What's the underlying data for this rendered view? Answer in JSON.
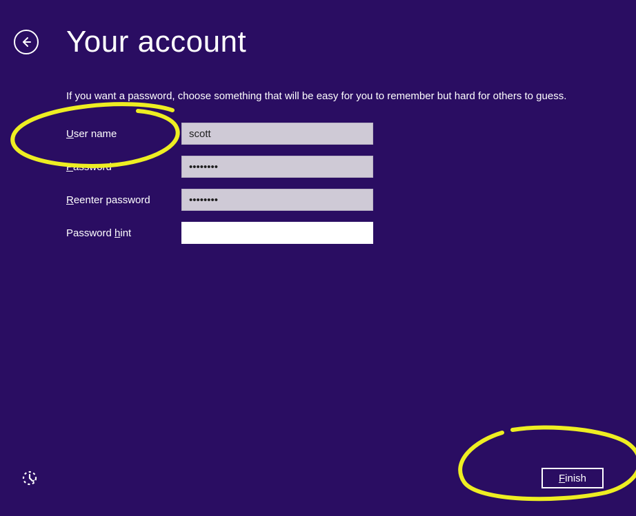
{
  "header": {
    "title": "Your account"
  },
  "instructions": "If you want a password, choose something that will be easy for you to remember but hard for others to guess.",
  "labels": {
    "username_pre": "U",
    "username_rest": "ser name",
    "password_pre": "P",
    "password_rest": "assword",
    "reenter_pre": "R",
    "reenter_rest": "eenter password",
    "hint_pre_a": "Password ",
    "hint_ul": "h",
    "hint_rest": "int"
  },
  "values": {
    "username": "scott",
    "password": "••••••••",
    "reenter": "••••••••",
    "hint": ""
  },
  "footer": {
    "finish_pre": "F",
    "finish_rest": "inish"
  }
}
